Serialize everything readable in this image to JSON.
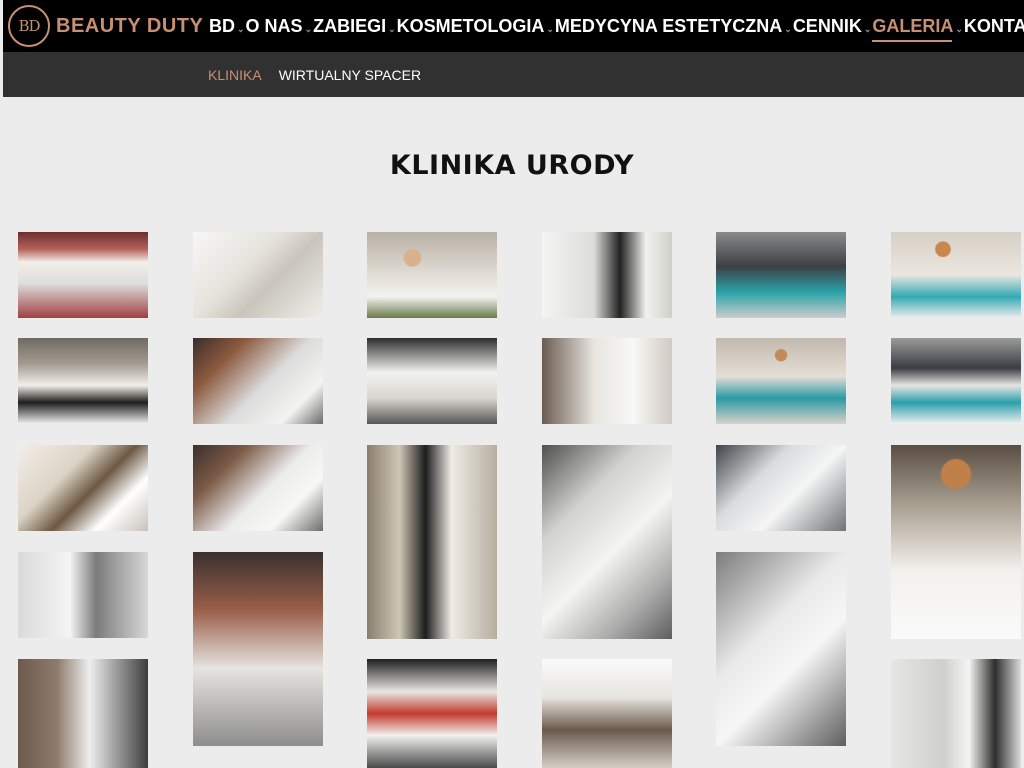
{
  "brand": {
    "logo_mark": "BD",
    "name": "BEAUTY DUTY"
  },
  "nav": {
    "items": [
      {
        "label": "BD"
      },
      {
        "label": "O NAS"
      },
      {
        "label": "ZABIEGI"
      },
      {
        "label": "KOSMETOLOGIA"
      },
      {
        "label": "MEDYCYNA ESTETYCZNA"
      },
      {
        "label": "CENNIK"
      },
      {
        "label": "GALERIA"
      },
      {
        "label": "KONTAKT"
      }
    ],
    "active": "GALERIA"
  },
  "subnav": {
    "items": [
      {
        "label": "KLINIKA"
      },
      {
        "label": "WIRTUALNY SPACER"
      }
    ],
    "active": "KLINIKA"
  },
  "page": {
    "title": "KLINIKA URODY"
  },
  "gallery": {
    "photo_count": 25
  },
  "colors": {
    "accent": "#c98f73",
    "topbar": "#000000",
    "subbar": "#313131",
    "background": "#ececec"
  }
}
